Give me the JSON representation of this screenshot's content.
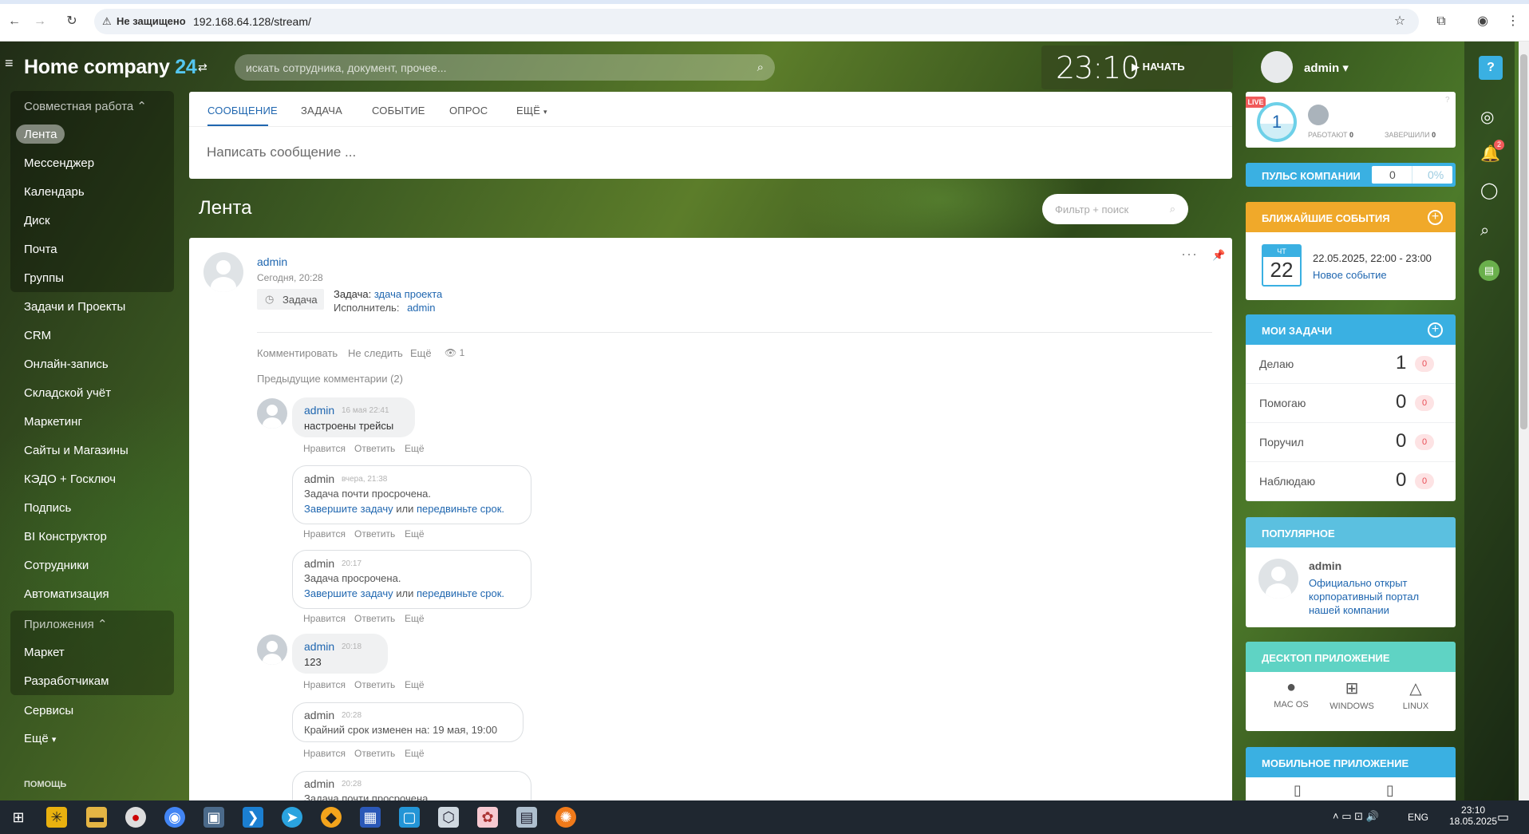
{
  "browser": {
    "not_secure": "Не защищено",
    "url": "192.168.64.128/stream/"
  },
  "header": {
    "brand_main": "Home company",
    "brand_num": "24",
    "search_placeholder": "искать сотрудника, документ, прочее...",
    "clock": "23:10",
    "start": "НАЧАТЬ",
    "user": "admin"
  },
  "sidebar": {
    "section1": "Совместная работа",
    "items1": [
      "Лента",
      "Мессенджер",
      "Календарь",
      "Диск",
      "Почта",
      "Группы"
    ],
    "items2": [
      "Задачи и Проекты",
      "CRM",
      "Онлайн-запись",
      "Складской учёт",
      "Маркетинг",
      "Сайты и Магазины",
      "КЭДО + Госключ",
      "Подпись",
      "BI Конструктор",
      "Сотрудники",
      "Автоматизация"
    ],
    "section2": "Приложения",
    "items3": [
      "Маркет",
      "Разработчикам"
    ],
    "items4": [
      "Сервисы",
      "Ещё"
    ],
    "help": "ПОМОЩЬ"
  },
  "composer": {
    "tabs": [
      "СООБЩЕНИЕ",
      "ЗАДАЧА",
      "СОБЫТИЕ",
      "ОПРОС",
      "ЕЩЁ"
    ],
    "placeholder": "Написать сообщение ..."
  },
  "feed": {
    "title": "Лента",
    "filter_placeholder": "Фильтр + поиск"
  },
  "post": {
    "author": "admin",
    "date": "Сегодня, 20:28",
    "tag": "Задача",
    "task_label": "Задача:",
    "task_link": "здача проекта",
    "exec_label": "Исполнитель:",
    "exec_link": "admin",
    "actions": [
      "Комментировать",
      "Не следить",
      "Ещё"
    ],
    "views": "1",
    "prev_comments": "Предыдущие комментарии (2)",
    "comment_actions": [
      "Нравится",
      "Ответить",
      "Ещё"
    ],
    "comments": [
      {
        "author": "admin",
        "time": "16 мая 22:41",
        "text": "настроены трейсы"
      },
      {
        "author": "admin",
        "time": "вчера, 21:38",
        "text": "Задача почти просрочена.",
        "link1": "Завершите задачу",
        "mid": "или",
        "link2": "передвиньте срок."
      },
      {
        "author": "admin",
        "time": "20:17",
        "text": "Задача просрочена.",
        "link1": "Завершите задачу",
        "mid": "или",
        "link2": "передвиньте срок."
      },
      {
        "author": "admin",
        "time": "20:18",
        "text": "123"
      },
      {
        "author": "admin",
        "time": "20:28",
        "text": "Крайний срок изменен на: 19 мая, 19:00"
      },
      {
        "author": "admin",
        "time": "20:28",
        "text": "Задача почти просрочена."
      }
    ]
  },
  "right": {
    "live": "LIVE",
    "count": "1",
    "working_label": "РАБОТАЮТ",
    "working": "0",
    "finished_label": "ЗАВЕРШИЛИ",
    "finished": "0",
    "pulse_label": "ПУЛЬС КОМПАНИИ",
    "pulse_value": "0",
    "pulse_pct": "0%",
    "events_title": "БЛИЖАЙШИЕ СОБЫТИЯ",
    "event_dow": "ЧТ",
    "event_day": "22",
    "event_time": "22.05.2025, 22:00 - 23:00",
    "event_name": "Новое событие",
    "tasks_title": "МОИ ЗАДАЧИ",
    "tasks": [
      {
        "label": "Делаю",
        "count": "1",
        "overdue": "0"
      },
      {
        "label": "Помогаю",
        "count": "0",
        "overdue": "0"
      },
      {
        "label": "Поручил",
        "count": "0",
        "overdue": "0"
      },
      {
        "label": "Наблюдаю",
        "count": "0",
        "overdue": "0"
      }
    ],
    "popular_title": "ПОПУЛЯРНОЕ",
    "popular_author": "admin",
    "popular_text1": "Официально открыт",
    "popular_text2": "корпоративный портал",
    "popular_text3": "нашей компании",
    "desktop_title": "ДЕСКТОП ПРИЛОЖЕНИЕ",
    "desktop_apps": [
      "MAC OS",
      "WINDOWS",
      "LINUX"
    ],
    "mobile_title": "МОБИЛЬНОЕ ПРИЛОЖЕНИЕ",
    "notif_badge": "2"
  },
  "taskbar": {
    "lang": "ENG",
    "time": "23:10",
    "date": "18.05.2025"
  },
  "colors": {
    "accent_blue": "#2067b0",
    "events": "#f0a92a",
    "tasks": "#3ab0e2",
    "popular": "#5bc0e0",
    "desktop": "#5fd3c4",
    "mobile": "#3ab0e2",
    "pulse": "#3ab0e2"
  }
}
